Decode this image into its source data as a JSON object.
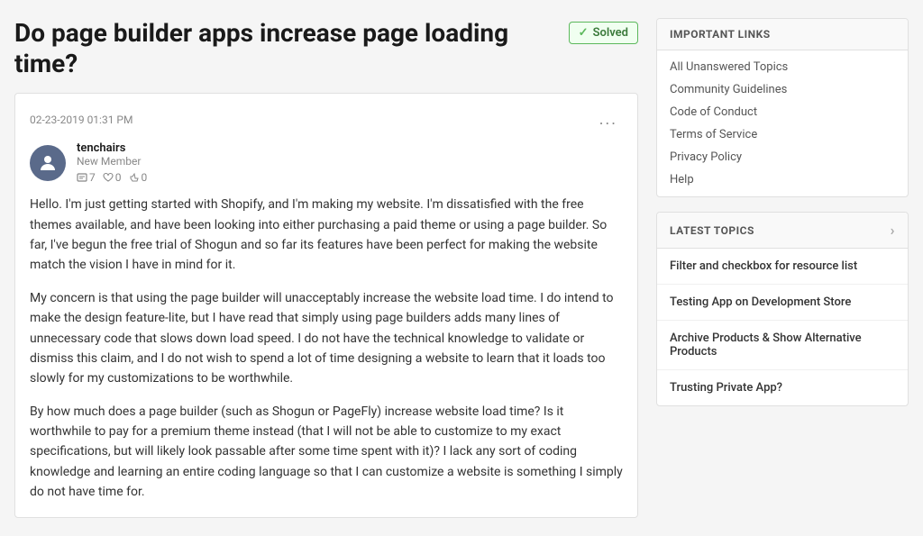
{
  "question": {
    "title": "Do page builder apps increase page loading time?",
    "solved_label": "Solved",
    "timestamp": "02-23-2019 01:31 PM",
    "more_options": "...",
    "author": {
      "name": "tenchairs",
      "role": "New Member",
      "avatar_label": "person",
      "stats": {
        "posts": "7",
        "likes_received": "0",
        "likes_given": "0"
      }
    },
    "body_paragraphs": [
      "Hello. I'm just getting started with Shopify, and I'm making my website. I'm dissatisfied with the free themes available, and have been looking into either purchasing a paid theme or using a page builder. So far, I've begun the free trial of Shogun and so far its features have been perfect for making the website match the vision I have in mind for it.",
      "My concern is that using the page builder will unacceptably increase the website load time. I do intend to make the design feature-lite, but I have read that simply using page builders adds many lines of unnecessary code that slows down load speed. I do not have the technical knowledge to validate or dismiss this claim, and I do not wish to spend a lot of time designing a website to learn that it loads too slowly for my customizations to be worthwhile.",
      "By how much does a page builder (such as Shogun or PageFly) increase website load time? Is it worthwhile to pay for a premium theme instead (that I will not be able to customize to my exact specifications, but will likely look passable after some time spent with it)? I lack any sort of coding knowledge and learning an entire coding language so that I can customize a website is something I simply do not have time for."
    ]
  },
  "sidebar": {
    "important_links": {
      "header": "IMPORTANT LINKS",
      "items": [
        {
          "label": "All Unanswered Topics",
          "url": "#"
        },
        {
          "label": "Community Guidelines",
          "url": "#"
        },
        {
          "label": "Code of Conduct",
          "url": "#"
        },
        {
          "label": "Terms of Service",
          "url": "#"
        },
        {
          "label": "Privacy Policy",
          "url": "#"
        },
        {
          "label": "Help",
          "url": "#"
        }
      ]
    },
    "latest_topics": {
      "header": "LATEST TOPICS",
      "items": [
        {
          "label": "Filter and checkbox for resource list"
        },
        {
          "label": "Testing App on Development Store"
        },
        {
          "label": "Archive Products & Show Alternative Products"
        },
        {
          "label": "Trusting Private App?"
        }
      ]
    }
  }
}
